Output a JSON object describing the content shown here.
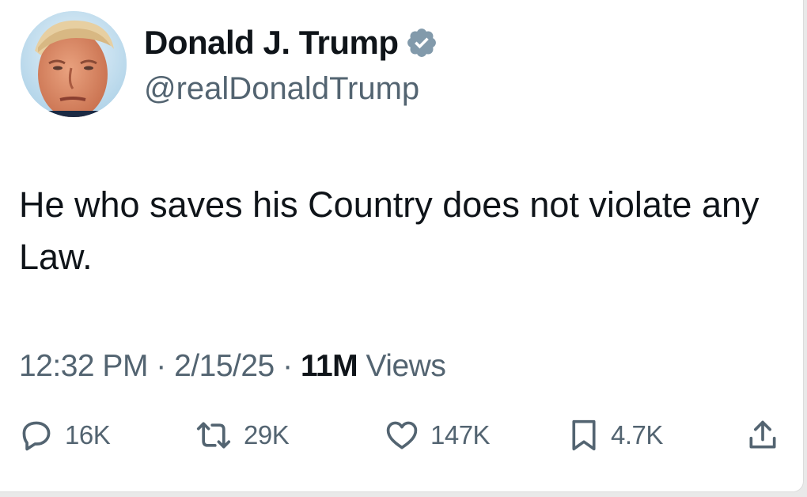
{
  "author": {
    "display_name": "Donald J. Trump",
    "handle": "@realDonaldTrump",
    "verified": true,
    "avatar_icon": "profile-photo"
  },
  "tweet": {
    "text": "He who saves his Country does not violate any Law."
  },
  "meta": {
    "time": "12:32 PM",
    "separator": "·",
    "date": "2/15/25",
    "views_count": "11M",
    "views_label": "Views"
  },
  "actions": {
    "replies": {
      "icon": "reply-icon",
      "count": "16K"
    },
    "reposts": {
      "icon": "repost-icon",
      "count": "29K"
    },
    "likes": {
      "icon": "heart-icon",
      "count": "147K"
    },
    "bookmarks": {
      "icon": "bookmark-icon",
      "count": "4.7K"
    },
    "share": {
      "icon": "share-icon"
    }
  },
  "colors": {
    "primary_text": "#0f1419",
    "secondary_text": "#536471",
    "verified_badge": "#829aab",
    "background": "#ffffff"
  }
}
